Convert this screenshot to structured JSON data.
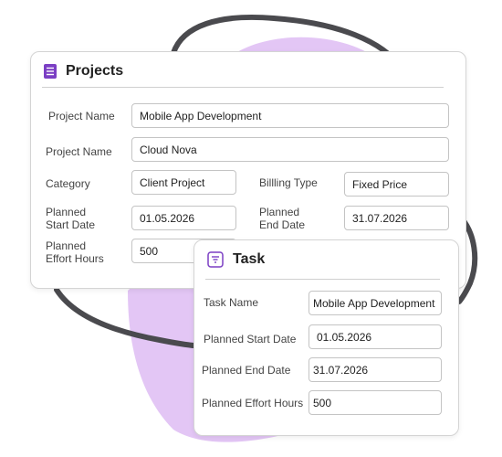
{
  "colors": {
    "accent": "#7b3fc4",
    "blob": "#e3c6f5",
    "loop": "#4a4a4e"
  },
  "projects": {
    "title": "Projects",
    "icon": "list-icon",
    "project_name_label_1": "Project Name",
    "project_name_value_1": "Mobile App Development",
    "project_name_label_2": "Project Name",
    "project_name_value_2": "Cloud Nova",
    "category_label": "Category",
    "category_value": "Client Project",
    "billing_type_label": "Billling Type",
    "billing_type_value": "Fixed Price",
    "planned_start_label_line1": "Planned",
    "planned_start_label_line2": "Start Date",
    "planned_start_value": "01.05.2026",
    "planned_end_label_line1": "Planned",
    "planned_end_label_line2": "End Date",
    "planned_end_value": "31.07.2026",
    "planned_effort_label_line1": "Planned",
    "planned_effort_label_line2": "Effort Hours",
    "planned_effort_value": "500"
  },
  "task": {
    "title": "Task",
    "icon": "filter-icon",
    "task_name_label": "Task Name",
    "task_name_value": "Mobile App Development",
    "planned_start_label": "Planned Start  Date",
    "planned_start_value": "01.05.2026",
    "planned_end_label": "Planned End Date",
    "planned_end_value": "31.07.2026",
    "planned_effort_label": "Planned Effort Hours",
    "planned_effort_value": "500"
  }
}
